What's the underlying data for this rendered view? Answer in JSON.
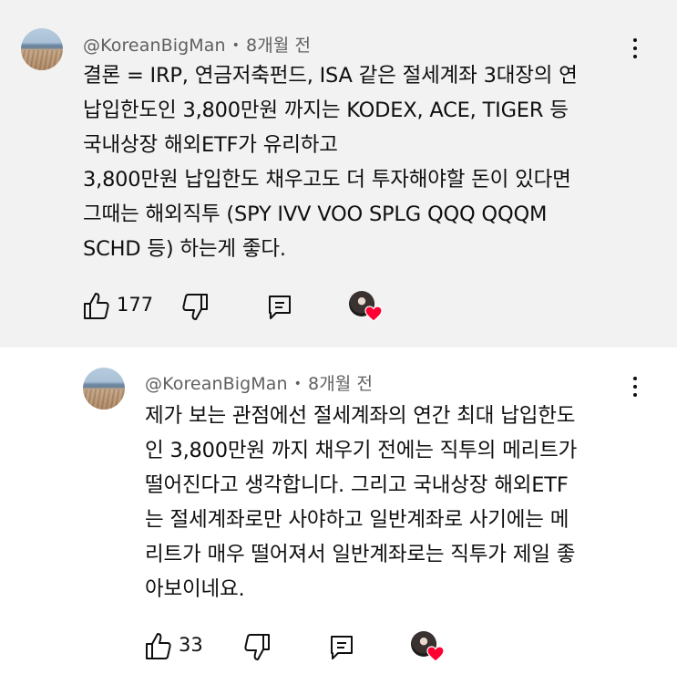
{
  "comments": [
    {
      "author": "@KoreanBigMan",
      "time": "8개월 전",
      "lines": [
        "결론 = IRP, 연금저축펀드, ISA 같은 절세계좌 3대장의 연",
        "납입한도인 3,800만원 까지는 KODEX, ACE, TIGER 등",
        "국내상장 해외ETF가 유리하고",
        "3,800만원 납입한도 채우고도 더 투자해야할 돈이 있다면",
        "그때는 해외직투 (SPY IVV VOO SPLG QQQ QQQM",
        "SCHD 등) 하는게 좋다."
      ],
      "likes": "177"
    },
    {
      "author": "@KoreanBigMan",
      "time": "8개월 전",
      "lines": [
        "제가 보는 관점에선 절세계좌의 연간 최대 납입한도",
        "인 3,800만원 까지 채우기 전에는 직투의 메리트가",
        "떨어진다고 생각합니다. 그리고 국내상장 해외ETF",
        "는 절세계좌로만 사야하고 일반계좌로 사기에는 메",
        "리트가 매우 떨어져서 일반계좌로는 직투가 제일 좋",
        "아보이네요."
      ],
      "likes": "33"
    }
  ],
  "colors": {
    "first_comment_bg": "#f2f2f2",
    "meta_text": "#606060",
    "heart": "#ff0033"
  },
  "icons": [
    "like-icon",
    "dislike-icon",
    "reply-icon",
    "creator-heart-icon",
    "more-vert-icon"
  ]
}
